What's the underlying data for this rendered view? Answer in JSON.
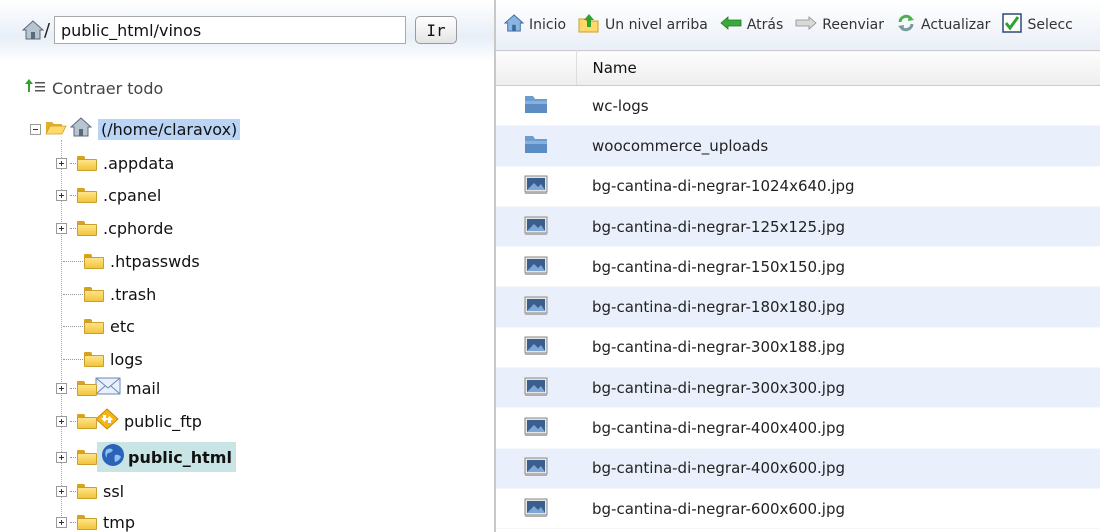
{
  "address_bar": {
    "path_value": "public_html/vinos",
    "slash": "/",
    "go_label": "Ir"
  },
  "tree": {
    "collapse_all_label": "Contraer todo",
    "root_label": "(/home/claravox)",
    "items": [
      {
        "label": ".appdata",
        "expandable": true
      },
      {
        "label": ".cpanel",
        "expandable": true
      },
      {
        "label": ".cphorde",
        "expandable": true
      },
      {
        "label": ".htpasswds",
        "expandable": false
      },
      {
        "label": ".trash",
        "expandable": false
      },
      {
        "label": "etc",
        "expandable": false
      },
      {
        "label": "logs",
        "expandable": false
      },
      {
        "label": "mail",
        "expandable": true,
        "icon": "mail-icon"
      },
      {
        "label": "public_ftp",
        "expandable": true,
        "icon": "ftp-icon"
      },
      {
        "label": "public_html",
        "expandable": true,
        "icon": "globe-icon",
        "selected": true
      },
      {
        "label": "ssl",
        "expandable": true
      },
      {
        "label": "tmp",
        "expandable": true
      }
    ]
  },
  "toolbar": {
    "home_label": "Inicio",
    "up_label": "Un nivel arriba",
    "back_label": "Atrás",
    "forward_label": "Reenviar",
    "refresh_label": "Actualizar",
    "select_label": "Selecc"
  },
  "table": {
    "header_name": "Name",
    "rows": [
      {
        "name": "wc-logs",
        "type": "folder"
      },
      {
        "name": "woocommerce_uploads",
        "type": "folder"
      },
      {
        "name": "bg-cantina-di-negrar-1024x640.jpg",
        "type": "image"
      },
      {
        "name": "bg-cantina-di-negrar-125x125.jpg",
        "type": "image"
      },
      {
        "name": "bg-cantina-di-negrar-150x150.jpg",
        "type": "image"
      },
      {
        "name": "bg-cantina-di-negrar-180x180.jpg",
        "type": "image"
      },
      {
        "name": "bg-cantina-di-negrar-300x188.jpg",
        "type": "image"
      },
      {
        "name": "bg-cantina-di-negrar-300x300.jpg",
        "type": "image"
      },
      {
        "name": "bg-cantina-di-negrar-400x400.jpg",
        "type": "image"
      },
      {
        "name": "bg-cantina-di-negrar-400x600.jpg",
        "type": "image"
      },
      {
        "name": "bg-cantina-di-negrar-600x600.jpg",
        "type": "image"
      }
    ]
  },
  "colors": {
    "selected_highlight": "#c9e4e4",
    "root_highlight": "#b9d4f4",
    "row_alt": "#e9f0fb",
    "folder_blue": "#6d9ccf",
    "folder_yellow": "#f2c43a"
  }
}
